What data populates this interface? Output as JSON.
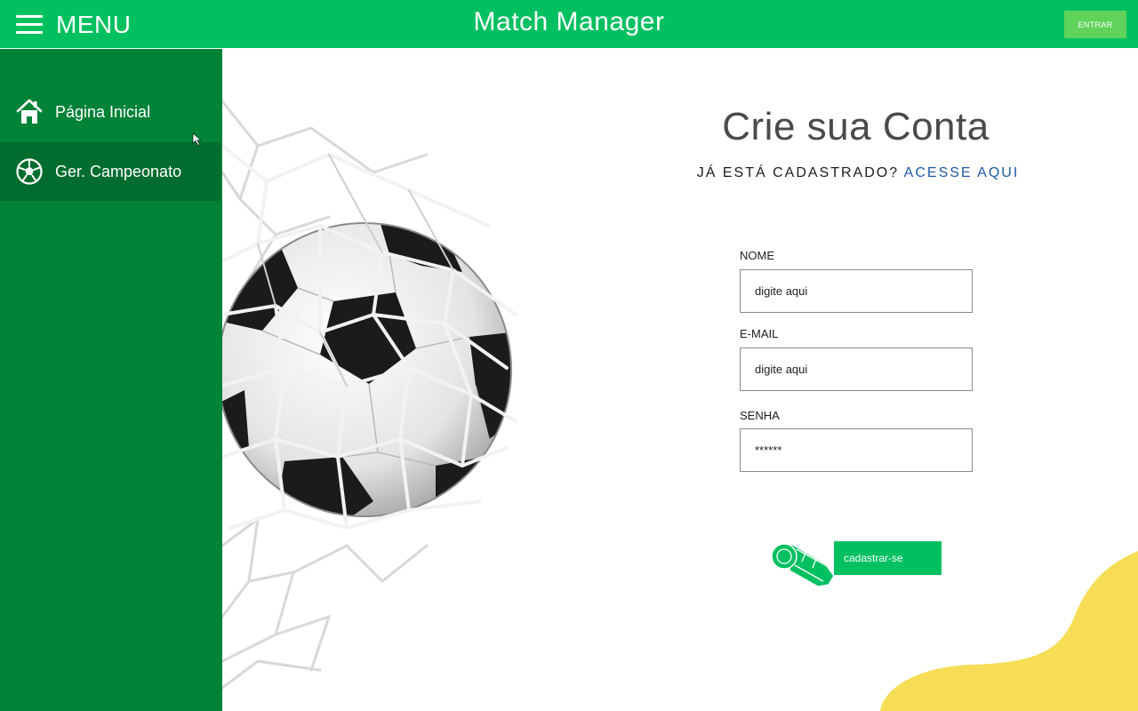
{
  "header": {
    "menu_label": "MENU",
    "title": "Match Manager",
    "login_label": "ENTRAR"
  },
  "sidebar": {
    "items": [
      {
        "label": "Página Inicial",
        "icon": "home-icon",
        "active": false
      },
      {
        "label": "Ger. Campeonato",
        "icon": "soccer-ball-icon",
        "active": true
      }
    ]
  },
  "form": {
    "title": "Crie sua Conta",
    "signin_prompt": "JÁ ESTÁ CADASTRADO?",
    "signin_link": "ACESSE AQUI",
    "fields": [
      {
        "label": "NOME",
        "value": "digite aqui"
      },
      {
        "label": "E-MAIL",
        "value": "digite aqui"
      },
      {
        "label": "SENHA",
        "value": "******"
      }
    ],
    "submit_label": "cadastrar-se",
    "submit_icon": "whistle-icon"
  },
  "colors": {
    "header_green": "#00c060",
    "sidebar_green": "#008237",
    "sidebar_active": "#006d2f",
    "login_button": "#5fd35a",
    "link_blue": "#1e5aa8",
    "accent_yellow": "#f6dd55"
  }
}
